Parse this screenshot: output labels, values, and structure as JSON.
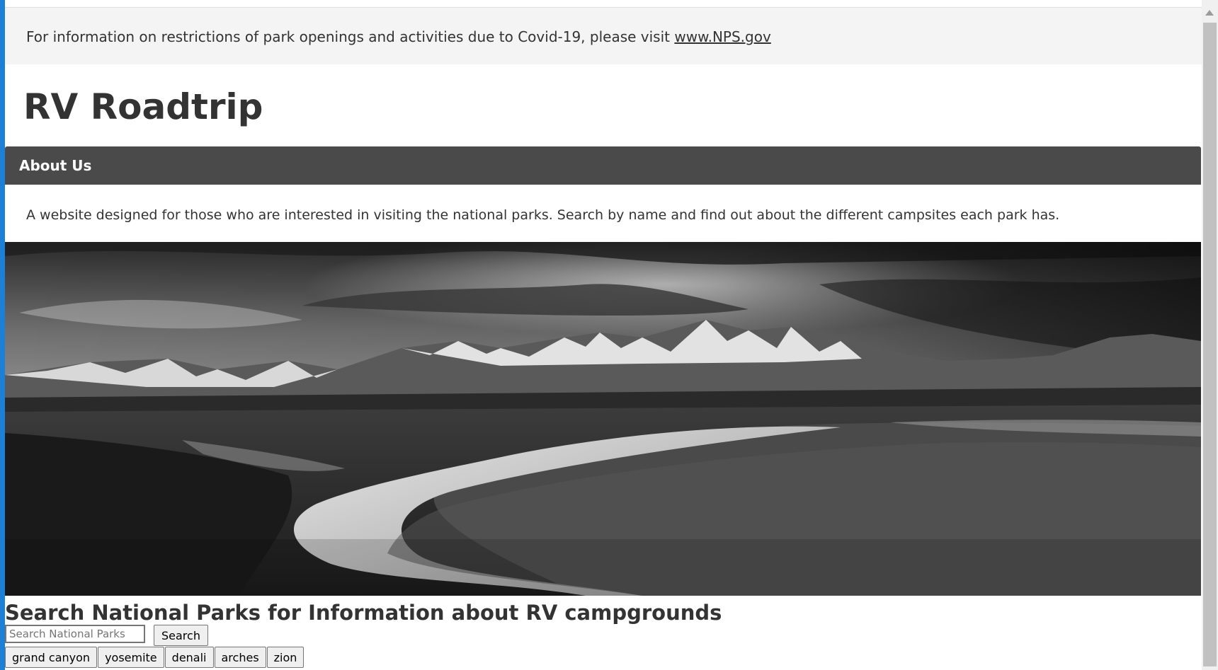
{
  "notice": {
    "text": "For information on restrictions of park openings and activities due to Covid-19, please visit ",
    "link_label": "www.NPS.gov"
  },
  "header": {
    "title": "RV Roadtrip"
  },
  "about": {
    "heading": "About Us",
    "description": "A website designed for those who are interested in visiting the national parks. Search by name and find out about the different campsites each park has."
  },
  "hero": {
    "image_subject": "black-and-white photo of a river winding below snow-capped mountains"
  },
  "search": {
    "heading": "Search National Parks for Information about RV campgrounds",
    "placeholder": "Search National Parks",
    "value": "",
    "button_label": "Search"
  },
  "quick_links": [
    {
      "label": "grand canyon"
    },
    {
      "label": "yosemite"
    },
    {
      "label": "denali"
    },
    {
      "label": "arches"
    },
    {
      "label": "zion"
    }
  ],
  "colors": {
    "notice_bg": "#f4f4f4",
    "about_bar_bg": "#4a4a4a",
    "text": "#333333",
    "window_edge": "#1e7fd6"
  }
}
